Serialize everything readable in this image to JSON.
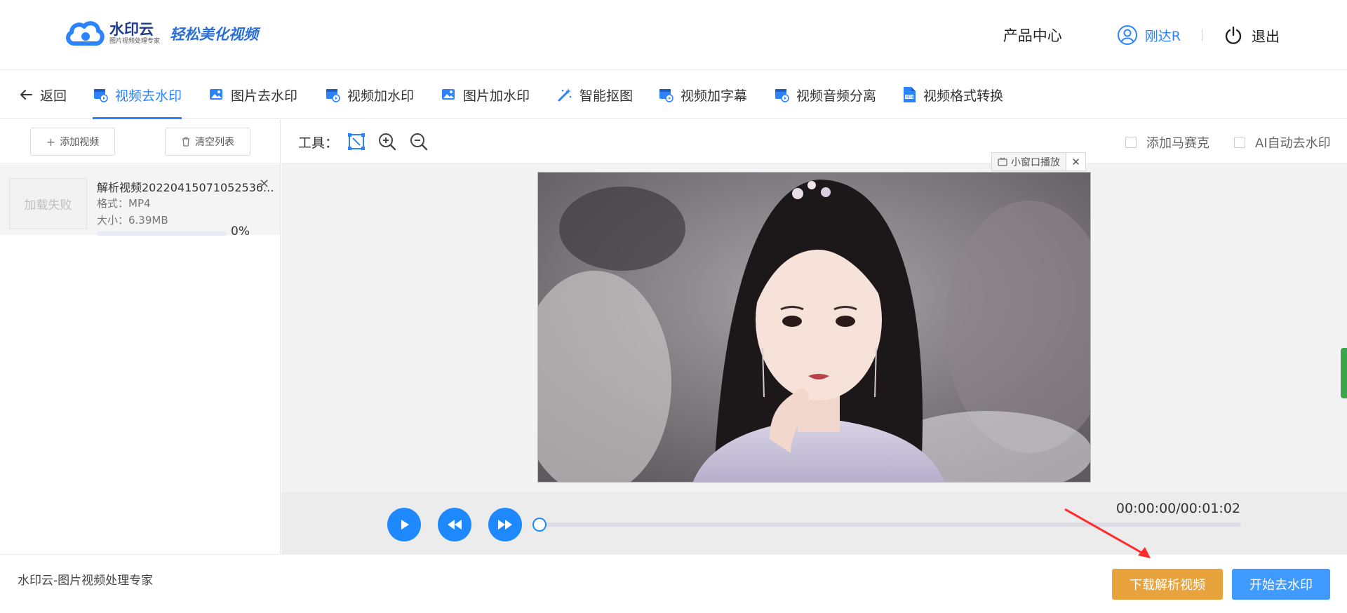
{
  "header": {
    "logo_name": "水印云",
    "logo_sub": "图片视频处理专家",
    "slogan": "轻松美化视频",
    "product_center": "产品中心",
    "username": "刚达R",
    "logout": "退出"
  },
  "tabs": [
    {
      "label": "返回",
      "icon": "back-arrow-icon"
    },
    {
      "label": "视频去水印",
      "icon": "video-icon",
      "active": true
    },
    {
      "label": "图片去水印",
      "icon": "image-icon"
    },
    {
      "label": "视频加水印",
      "icon": "video-icon"
    },
    {
      "label": "图片加水印",
      "icon": "image-icon"
    },
    {
      "label": "智能抠图",
      "icon": "magic-wand-icon"
    },
    {
      "label": "视频加字幕",
      "icon": "video-icon"
    },
    {
      "label": "视频音频分离",
      "icon": "video-icon"
    },
    {
      "label": "视频格式转换",
      "icon": "mp4-file-icon"
    }
  ],
  "left_panel": {
    "add_video": "添加视频",
    "clear_list": "清空列表",
    "file": {
      "thumb_text": "加载失败",
      "name": "解析视频20220415071052536...",
      "format": "格式：MP4",
      "size": "大小：6.39MB",
      "progress": 0,
      "progress_text": "0%"
    }
  },
  "toolbar": {
    "tools_label": "工具：",
    "mosaic_label": "添加马赛克",
    "ai_label": "AI自动去水印",
    "mini_window": "小窗口播放"
  },
  "player": {
    "timecode": "00:00:00/00:01:02",
    "progress": 0
  },
  "footer": {
    "brand": "水印云-图片视频处理专家",
    "download": "下载解析视频",
    "start": "开始去水印"
  },
  "colors": {
    "accent": "#2b83ff",
    "orange": "#e8a33d",
    "blue_button": "#3f9bff"
  }
}
